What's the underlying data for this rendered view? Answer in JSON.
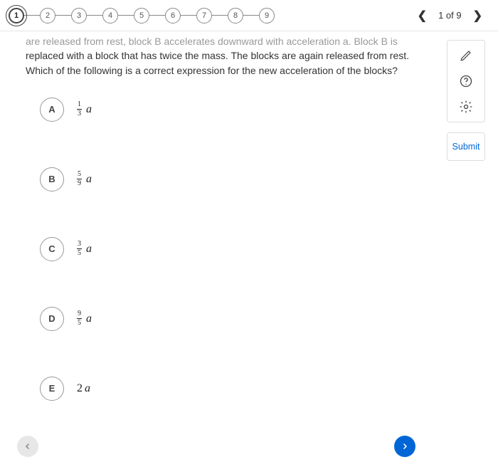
{
  "progress": {
    "steps": [
      "1",
      "2",
      "3",
      "4",
      "5",
      "6",
      "7",
      "8",
      "9"
    ],
    "current_index": 0
  },
  "topnav": {
    "counter": "1 of 9"
  },
  "question": {
    "cutoff_line": "are released from rest, block B accelerates downward with acceleration a. Block B is",
    "line2": "replaced with a block that has twice the mass. The blocks are again released from rest.",
    "line3": "Which of the following is a correct expression for the new acceleration of the blocks?"
  },
  "options": [
    {
      "letter": "A",
      "num": "1",
      "den": "3",
      "var": "a"
    },
    {
      "letter": "B",
      "num": "5",
      "den": "9",
      "var": "a"
    },
    {
      "letter": "C",
      "num": "3",
      "den": "5",
      "var": "a"
    },
    {
      "letter": "D",
      "num": "9",
      "den": "5",
      "var": "a"
    },
    {
      "letter": "E",
      "coef": "2",
      "var": "a"
    }
  ],
  "sidebar": {
    "submit": "Submit"
  }
}
